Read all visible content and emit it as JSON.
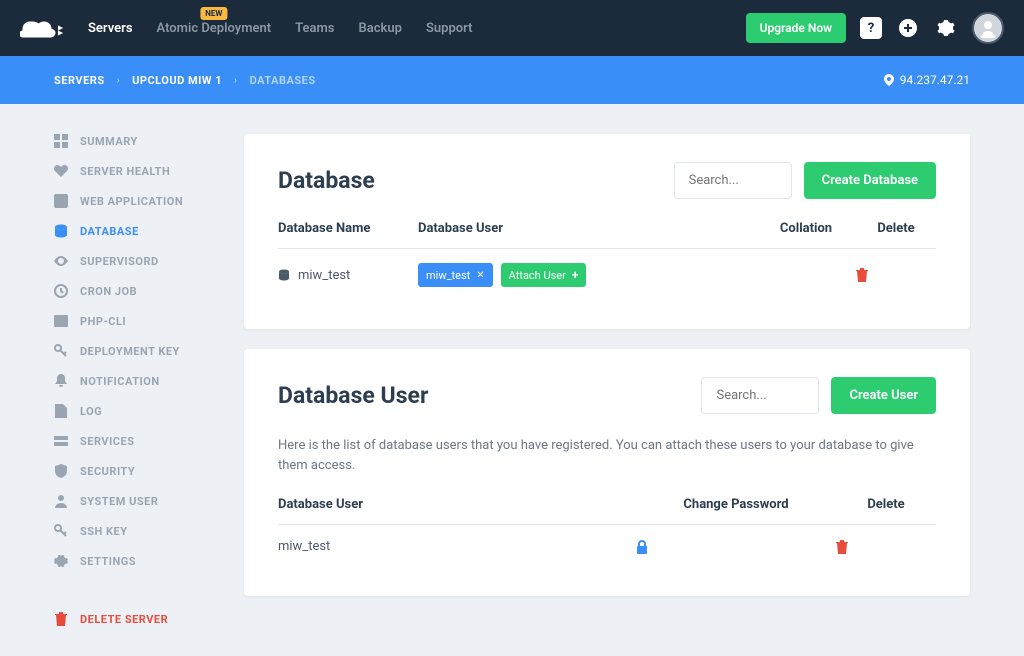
{
  "topnav": {
    "items": [
      "Servers",
      "Atomic Deployment",
      "Teams",
      "Backup",
      "Support"
    ],
    "badge": "NEW",
    "upgrade": "Upgrade Now",
    "help": "?"
  },
  "breadcrumb": {
    "items": [
      "SERVERS",
      "UPCLOUD MIW 1",
      "DATABASES"
    ],
    "ip": "94.237.47.21"
  },
  "sidebar": {
    "items": [
      {
        "label": "SUMMARY"
      },
      {
        "label": "SERVER HEALTH"
      },
      {
        "label": "WEB APPLICATION"
      },
      {
        "label": "DATABASE"
      },
      {
        "label": "SUPERVISORD"
      },
      {
        "label": "CRON JOB"
      },
      {
        "label": "PHP-CLI"
      },
      {
        "label": "DEPLOYMENT KEY"
      },
      {
        "label": "NOTIFICATION"
      },
      {
        "label": "LOG"
      },
      {
        "label": "SERVICES"
      },
      {
        "label": "SECURITY"
      },
      {
        "label": "SYSTEM USER"
      },
      {
        "label": "SSH KEY"
      },
      {
        "label": "SETTINGS"
      }
    ],
    "delete": "DELETE SERVER"
  },
  "database": {
    "title": "Database",
    "search_placeholder": "Search...",
    "create_btn": "Create Database",
    "headers": {
      "name": "Database Name",
      "user": "Database User",
      "collation": "Collation",
      "delete": "Delete"
    },
    "rows": [
      {
        "name": "miw_test",
        "users": [
          "miw_test"
        ],
        "attach": "Attach User"
      }
    ]
  },
  "dbuser": {
    "title": "Database User",
    "search_placeholder": "Search...",
    "create_btn": "Create User",
    "description": "Here is the list of database users that you have registered. You can attach these users to your database to give them access.",
    "headers": {
      "user": "Database User",
      "pwd": "Change Password",
      "delete": "Delete"
    },
    "rows": [
      {
        "name": "miw_test"
      }
    ]
  }
}
